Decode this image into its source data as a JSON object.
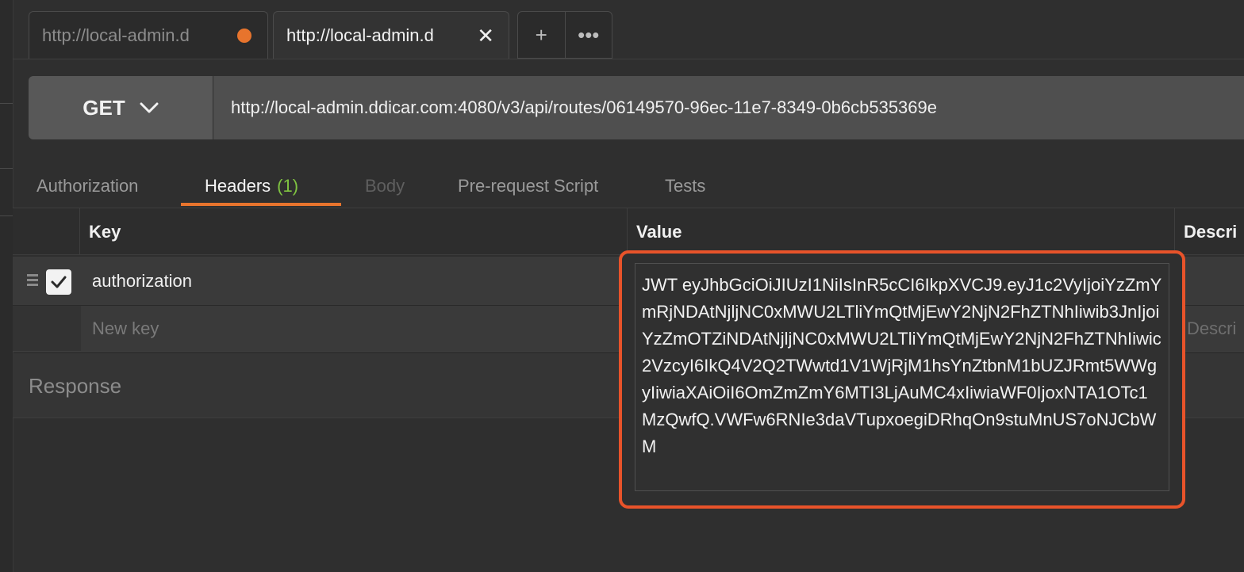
{
  "tabs": [
    {
      "title": "http://local-admin.d",
      "state": "unsaved",
      "dot_color": "#e7742d"
    },
    {
      "title": "http://local-admin.d",
      "state": "active"
    }
  ],
  "tab_tools": {
    "new_tab_icon": "plus-icon",
    "more_icon": "ellipsis-icon"
  },
  "request": {
    "method": "GET",
    "url": "http://local-admin.ddicar.com:4080/v3/api/routes/06149570-96ec-11e7-8349-0b6cb535369e"
  },
  "subtabs": {
    "authorization": "Authorization",
    "headers": "Headers",
    "headers_count": "(1)",
    "body": "Body",
    "prerequest": "Pre-request Script",
    "tests": "Tests"
  },
  "headers_table": {
    "columns": {
      "key": "Key",
      "value": "Value",
      "description": "Descri"
    },
    "rows": [
      {
        "enabled": true,
        "key": "authorization"
      }
    ],
    "new_row": {
      "key_placeholder": "New key",
      "description_placeholder": "Descri"
    }
  },
  "response": {
    "label": "Response"
  },
  "value_editor": {
    "value": "JWT eyJhbGciOiJIUzI1NiIsInR5cCI6IkpXVCJ9.eyJ1c2VyIjoiYzZmYmRjNDAtNjljNC0xMWU2LTliYmQtMjEwY2NjN2FhZTNhIiwib3JnIjoiYzZmOTZiNDAtNjljNC0xMWU2LTliYmQtMjEwY2NjN2FhZTNhIiwic2VzcyI6IkQ4V2Q2TWwtd1V1WjRjM1hsYnZtbnM1bUZJRmt5WWgyIiwiaXAiOiI6OmZmZmY6MTI3LjAuMC4xIiwiaWF0IjoxNTA1OTc1MzQwfQ.VWFw6RNIe3daVTupxoegiDRhqOn9stuMnUS7oNJCbWM",
    "highlight_color": "#e8532a"
  },
  "accent_color": "#e7742d"
}
